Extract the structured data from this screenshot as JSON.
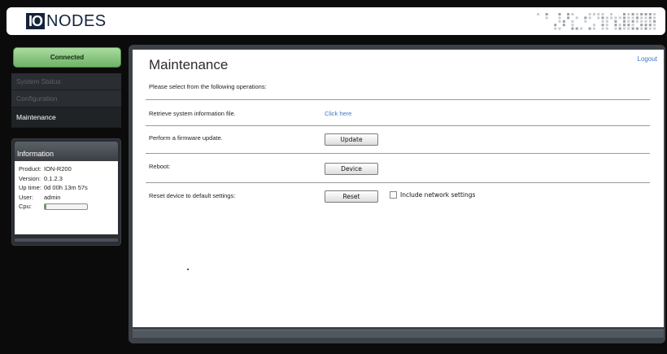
{
  "header": {
    "logo_box": "IO",
    "logo_text": "NODES"
  },
  "status": {
    "label": "Connected"
  },
  "nav": {
    "items": [
      {
        "label": "System Status"
      },
      {
        "label": "Configuration"
      },
      {
        "label": "Maintenance"
      }
    ]
  },
  "info": {
    "title": "Information",
    "rows": [
      {
        "key": "Product:",
        "value": "ION-R200"
      },
      {
        "key": "Version:",
        "value": "0.1.2.3"
      },
      {
        "key": "Up time:",
        "value": "0d 00h 13m 57s"
      },
      {
        "key": "User:",
        "value": "admin"
      },
      {
        "key": "Cpu:",
        "value": ""
      }
    ],
    "cpu_fraction": 0.04
  },
  "main": {
    "title": "Maintenance",
    "logout": "Logout",
    "subtitle": "Please select from the following operations:",
    "ops": [
      {
        "label": "Retrieve system information file.",
        "action": "Click here"
      },
      {
        "label": "Perform a firmware update.",
        "action": "Update"
      },
      {
        "label": "Reboot:",
        "action": "Device"
      },
      {
        "label": "Reset device to default settings:",
        "action": "Reset"
      }
    ],
    "checkbox_label": "Include network settings",
    "checkbox_checked": false
  },
  "colors": {
    "connected": "#7bbf72",
    "link": "#3a78c4",
    "brand": "#14233a"
  }
}
